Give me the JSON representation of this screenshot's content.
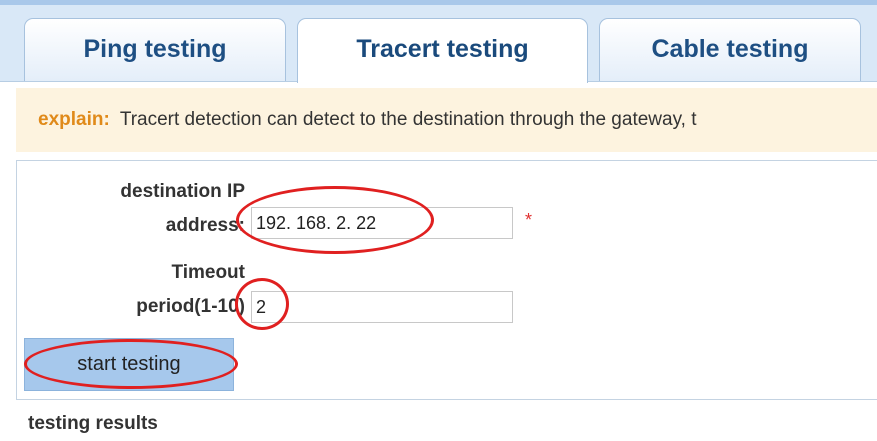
{
  "tabs": [
    {
      "label": "Ping testing",
      "active": false
    },
    {
      "label": "Tracert testing",
      "active": true
    },
    {
      "label": "Cable testing",
      "active": false
    }
  ],
  "explain": {
    "label": "explain:",
    "text": "Tracert detection can detect to the destination through the gateway, t"
  },
  "form": {
    "destination": {
      "label_line1": "destination IP",
      "label_line2": "address:",
      "value": "192. 168. 2. 22",
      "required_mark": "*"
    },
    "timeout": {
      "label_line1": "Timeout",
      "label_line2": "period(1-10)",
      "value": "2"
    }
  },
  "start_button": "start testing",
  "results_label": "testing results",
  "colors": {
    "accent": "#1e4f83",
    "explain_label": "#e08a1a",
    "annotation": "#e02020",
    "button": "#a6c8ec"
  }
}
